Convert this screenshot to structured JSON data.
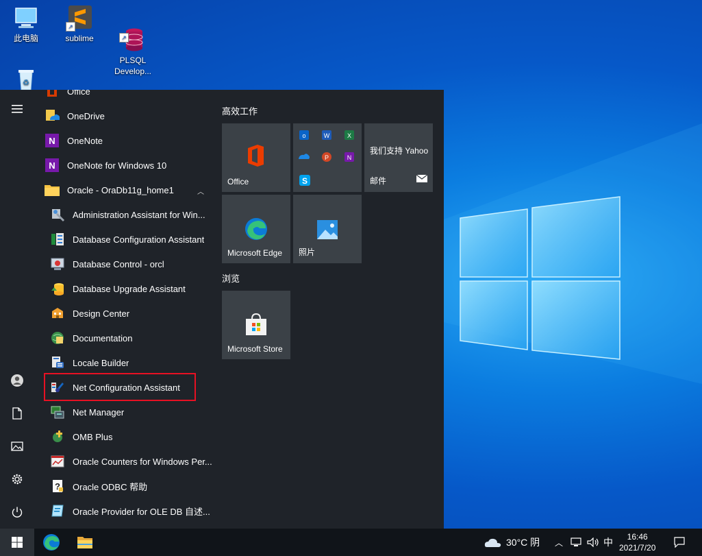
{
  "desktop": {
    "icons": [
      {
        "label": "此电脑"
      },
      {
        "label": "sublime"
      },
      {
        "label": "PLSQL\nDevelop..."
      },
      {
        "label": ""
      }
    ]
  },
  "start_menu": {
    "apps": [
      {
        "label": "Office",
        "icon": "office-icon"
      },
      {
        "label": "OneDrive",
        "icon": "onedrive-icon"
      },
      {
        "label": "OneNote",
        "icon": "onenote-icon"
      },
      {
        "label": "OneNote for Windows 10",
        "icon": "onenote-icon"
      },
      {
        "label": "Oracle - OraDb11g_home1",
        "icon": "folder-icon"
      },
      {
        "label": "Administration Assistant for Win...",
        "icon": "admin-assistant-icon"
      },
      {
        "label": "Database Configuration Assistant",
        "icon": "db-config-icon"
      },
      {
        "label": "Database Control - orcl",
        "icon": "db-control-icon"
      },
      {
        "label": "Database Upgrade Assistant",
        "icon": "db-upgrade-icon"
      },
      {
        "label": "Design Center",
        "icon": "design-center-icon"
      },
      {
        "label": "Documentation",
        "icon": "documentation-icon"
      },
      {
        "label": "Locale Builder",
        "icon": "locale-builder-icon"
      },
      {
        "label": "Net Configuration Assistant",
        "icon": "net-config-icon"
      },
      {
        "label": "Net Manager",
        "icon": "net-manager-icon"
      },
      {
        "label": "OMB Plus",
        "icon": "omb-plus-icon"
      },
      {
        "label": "Oracle Counters for Windows Per...",
        "icon": "counters-icon"
      },
      {
        "label": "Oracle ODBC 帮助",
        "icon": "odbc-help-icon"
      },
      {
        "label": "Oracle Provider for OLE DB 自述...",
        "icon": "ole-db-icon"
      }
    ],
    "sections": {
      "productivity": "高效工作",
      "browse": "浏览"
    },
    "tiles": {
      "office": "Office",
      "mail_title": "我们支持 Yahoo",
      "mail": "邮件",
      "edge": "Microsoft Edge",
      "photos": "照片",
      "store": "Microsoft Store"
    }
  },
  "taskbar": {
    "weather": "30°C 阴",
    "ime": "中",
    "time": "16:46",
    "date": "2021/7/20"
  },
  "colors": {
    "start_bg": "#1f2329",
    "tile_bg": "#3b4147",
    "highlight": "#e81123"
  }
}
